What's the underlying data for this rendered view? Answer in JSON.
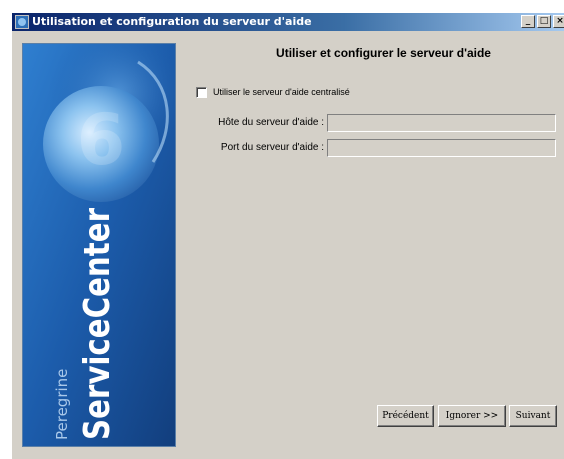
{
  "window": {
    "title": "Utilisation et configuration du serveur d'aide",
    "title_icon": "app-icon",
    "controls": {
      "minimize_label": "_",
      "maximize_label": "□",
      "close_label": "×"
    }
  },
  "side_panel": {
    "logo_icon": "peregrine-servicecenter-logo",
    "brand_small": "Peregrine",
    "brand_large": "ServiceCenter",
    "emblem_number": "6"
  },
  "main": {
    "heading": "Utiliser et configurer le serveur d'aide",
    "checkbox": {
      "label": "Utiliser le serveur d'aide centralisé",
      "checked": false
    },
    "host_field": {
      "label": "Hôte du serveur d'aide :",
      "value": ""
    },
    "port_field": {
      "label": "Port du serveur d'aide :",
      "value": ""
    }
  },
  "buttons": {
    "previous": "Précédent",
    "skip": "Ignorer >>",
    "next": "Suivant"
  },
  "colors": {
    "title_bar_start": "#0a246a",
    "title_bar_end": "#a6caf0",
    "panel_blue": "#1a4f9a",
    "dialog_face": "#d4d0c8"
  }
}
